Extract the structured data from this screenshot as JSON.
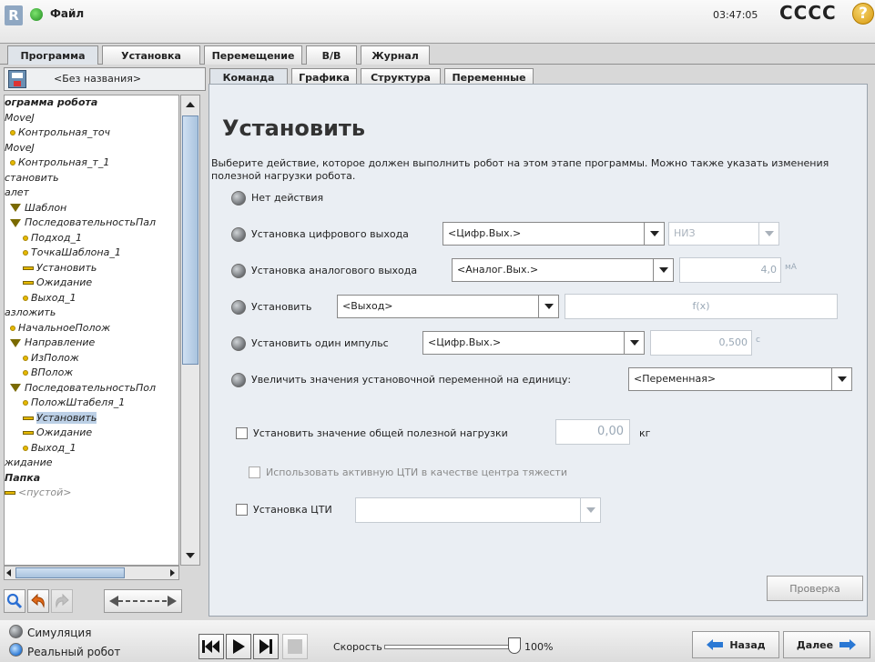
{
  "titlebar": {
    "file_label": "Файл",
    "time": "03:47:05",
    "robot_name": "CCCC"
  },
  "main_tabs": [
    {
      "label": "Программа"
    },
    {
      "label": "Установка"
    },
    {
      "label": "Перемещение"
    },
    {
      "label": "В/В"
    },
    {
      "label": "Журнал"
    }
  ],
  "program_name": "<Без названия>",
  "sub_tabs": [
    {
      "label": "Команда"
    },
    {
      "label": "Графика"
    },
    {
      "label": "Структура"
    },
    {
      "label": "Переменные"
    }
  ],
  "tree": [
    {
      "label": "ограмма робота",
      "bold": true
    },
    {
      "label": "MoveJ"
    },
    {
      "label": "Контрольная_точ"
    },
    {
      "label": "MoveJ"
    },
    {
      "label": "Контрольная_т_1"
    },
    {
      "label": "становить"
    },
    {
      "label": "алет"
    },
    {
      "label": "Шаблон"
    },
    {
      "label": "ПоследовательностьПал"
    },
    {
      "label": "Подход_1"
    },
    {
      "label": "ТочкаШаблона_1"
    },
    {
      "label": "Установить"
    },
    {
      "label": "Ожидание"
    },
    {
      "label": "Выход_1"
    },
    {
      "label": "азложить"
    },
    {
      "label": "НачальноеПолож"
    },
    {
      "label": "Направление"
    },
    {
      "label": "ИзПолож"
    },
    {
      "label": "ВПолож"
    },
    {
      "label": "ПоследовательностьПол"
    },
    {
      "label": "ПоложШтабеля_1"
    },
    {
      "label": "Установить"
    },
    {
      "label": "Ожидание"
    },
    {
      "label": "Выход_1"
    },
    {
      "label": "жидание"
    },
    {
      "label": "Папка",
      "bold": true
    },
    {
      "label": "<пустой>"
    }
  ],
  "content": {
    "title": "Установить",
    "description": "Выберите действие, которое должен выполнить робот на этом этапе программы. Можно также указать изменения полезной нагрузки робота.",
    "no_action": "Нет действия",
    "digital": {
      "label": "Установка цифрового выхода",
      "select": "<Цифр.Вых.>",
      "level": "НИЗ"
    },
    "analog": {
      "label": "Установка аналогового выхода",
      "select": "<Аналог.Вых.>",
      "value": "4,0",
      "unit": "мА"
    },
    "set": {
      "label": "Установить",
      "select": "<Выход>",
      "expr": "f(x)"
    },
    "pulse": {
      "label": "Установить один импульс",
      "select": "<Цифр.Вых.>",
      "value": "0,500",
      "unit": "с"
    },
    "increment": {
      "label": "Увеличить значения установочной переменной на единицу:",
      "select": "<Переменная>"
    },
    "payload": {
      "label": "Установить значение общей полезной нагрузки",
      "value": "0,00",
      "unit": "кг"
    },
    "tcp_cog": {
      "label": "Использовать активную ЦТИ в качестве центра тяжести"
    },
    "tcp": {
      "label": "Установка ЦТИ"
    },
    "check_button": "Проверка"
  },
  "bottom": {
    "simulation": "Симуляция",
    "real_robot": "Реальный робот",
    "speed_label": "Скорость",
    "speed_value": "100%",
    "speed_fraction": 1.0,
    "back": "Назад",
    "next": "Далее"
  }
}
